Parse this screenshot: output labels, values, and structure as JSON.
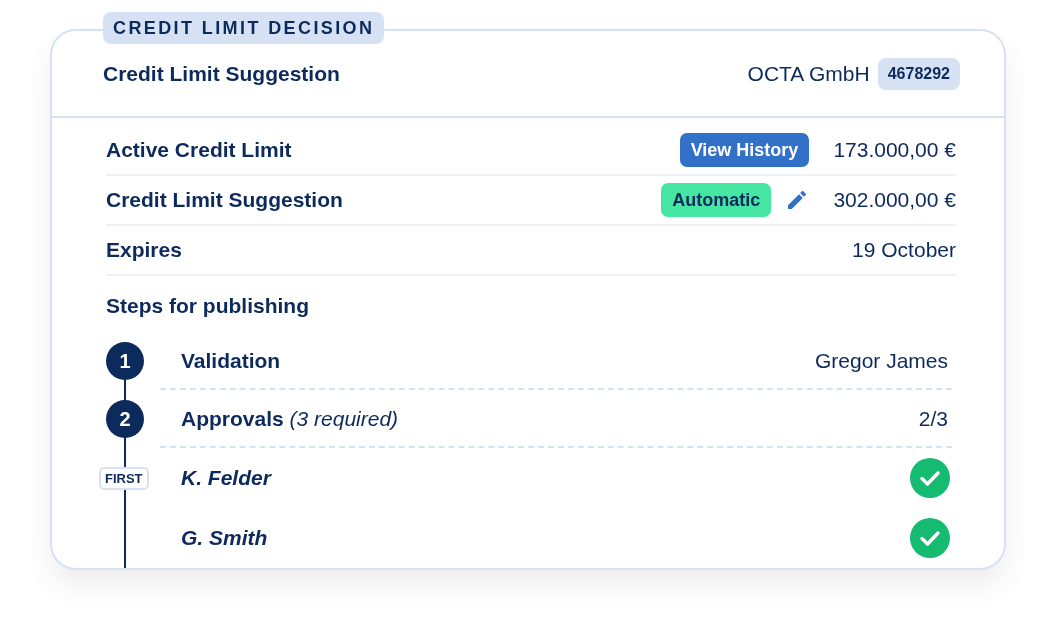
{
  "section_label": "CREDIT LIMIT DECISION",
  "header": {
    "title": "Credit Limit Suggestion",
    "company": "OCTA GmbH",
    "company_id": "4678292"
  },
  "fields": [
    {
      "label": "Active Credit Limit",
      "action": {
        "kind": "button",
        "text": "View History"
      },
      "value": "173.000,00 €"
    },
    {
      "label": "Credit Limit Suggestion",
      "action": {
        "kind": "tag",
        "text": "Automatic"
      },
      "editable": true,
      "value": "302.000,00 €"
    },
    {
      "label": "Expires",
      "value": "19 October"
    }
  ],
  "steps_title": "Steps for publishing",
  "steps": [
    {
      "number": "1",
      "title": "Validation",
      "value": "Gregor James"
    },
    {
      "number": "2",
      "title": "Approvals",
      "note": "(3 required)",
      "value": "2/3"
    }
  ],
  "approvers": [
    {
      "name": "K. Felder",
      "marker": "FIRST",
      "approved": true
    },
    {
      "name": "G. Smith",
      "approved": true
    }
  ]
}
